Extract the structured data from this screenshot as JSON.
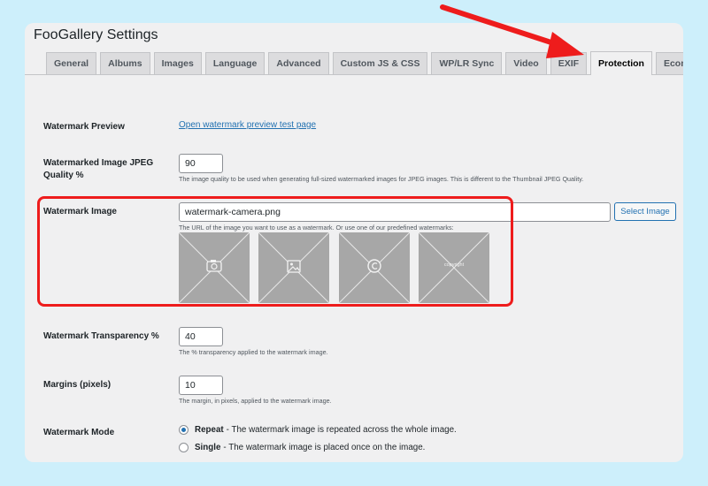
{
  "header": {
    "title": "FooGallery Settings"
  },
  "tabs": [
    {
      "label": "General"
    },
    {
      "label": "Albums"
    },
    {
      "label": "Images"
    },
    {
      "label": "Language"
    },
    {
      "label": "Advanced"
    },
    {
      "label": "Custom JS & CSS"
    },
    {
      "label": "WP/LR Sync"
    },
    {
      "label": "Video"
    },
    {
      "label": "EXIF"
    },
    {
      "label": "Protection"
    },
    {
      "label": "Ecommerce"
    }
  ],
  "active_tab": "Protection",
  "settings": {
    "preview": {
      "label": "Watermark Preview",
      "link": "Open watermark preview test page"
    },
    "quality": {
      "label": "Watermarked Image JPEG Quality %",
      "value": "90",
      "description": "The image quality to be used when generating full-sized watermarked images for JPEG images. This is different to the Thumbnail JPEG Quality."
    },
    "image": {
      "label": "Watermark Image",
      "value": "watermark-camera.png",
      "button": "Select Image",
      "description": "The URL of the image you want to use as a watermark. Or use one of our predefined watermarks:",
      "predefined": [
        {
          "icon": "camera-icon"
        },
        {
          "icon": "picture-icon"
        },
        {
          "icon": "copyright-icon"
        },
        {
          "icon": "copyright-text",
          "text": "copyright"
        }
      ]
    },
    "transparency": {
      "label": "Watermark Transparency %",
      "value": "40",
      "description": "The % transparency applied to the watermark image."
    },
    "margins": {
      "label": "Margins (pixels)",
      "value": "10",
      "description": "The margin, in pixels, applied to the watermark image."
    },
    "mode": {
      "label": "Watermark Mode",
      "options": [
        {
          "name": "Repeat",
          "description": " - The watermark image is repeated across the whole image.",
          "checked": true
        },
        {
          "name": "Single",
          "description": " - The watermark image is placed once on the image.",
          "checked": false
        }
      ]
    }
  },
  "colors": {
    "highlight": "#ee1c1c",
    "accent": "#2271b1"
  }
}
